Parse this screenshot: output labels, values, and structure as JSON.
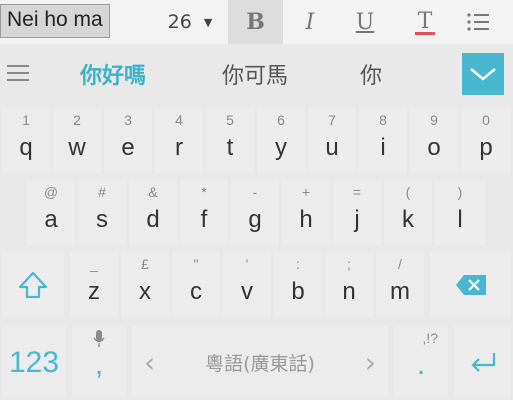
{
  "toolbar": {
    "font_size": "26",
    "bold": "B",
    "italic": "I",
    "underline": "U",
    "text_color": "T",
    "partial": "..."
  },
  "composing_text": "Nei ho ma",
  "candidates": [
    "你好嗎",
    "你可馬",
    "你"
  ],
  "keys": {
    "row1": [
      {
        "hint": "1",
        "main": "q"
      },
      {
        "hint": "2",
        "main": "w"
      },
      {
        "hint": "3",
        "main": "e"
      },
      {
        "hint": "4",
        "main": "r"
      },
      {
        "hint": "5",
        "main": "t"
      },
      {
        "hint": "6",
        "main": "y"
      },
      {
        "hint": "7",
        "main": "u"
      },
      {
        "hint": "8",
        "main": "i"
      },
      {
        "hint": "9",
        "main": "o"
      },
      {
        "hint": "0",
        "main": "p"
      }
    ],
    "row2": [
      {
        "hint": "@",
        "main": "a"
      },
      {
        "hint": "#",
        "main": "s"
      },
      {
        "hint": "&",
        "main": "d"
      },
      {
        "hint": "*",
        "main": "f"
      },
      {
        "hint": "-",
        "main": "g"
      },
      {
        "hint": "+",
        "main": "h"
      },
      {
        "hint": "=",
        "main": "j"
      },
      {
        "hint": "(",
        "main": "k"
      },
      {
        "hint": ")",
        "main": "l"
      }
    ],
    "row3": [
      {
        "hint": "_",
        "main": "z"
      },
      {
        "hint": "£",
        "main": "x"
      },
      {
        "hint": "\"",
        "main": "c"
      },
      {
        "hint": "'",
        "main": "v"
      },
      {
        "hint": ":",
        "main": "b"
      },
      {
        "hint": ";",
        "main": "n"
      },
      {
        "hint": "/",
        "main": "m"
      }
    ],
    "numbers": "123",
    "comma": ",",
    "space_label": "粵語(廣東話)",
    "period": ".",
    "period_hint": ",!?"
  },
  "colors": {
    "accent": "#47b8d0",
    "key_text": "#333333",
    "hint_text": "#8a8a8a"
  }
}
